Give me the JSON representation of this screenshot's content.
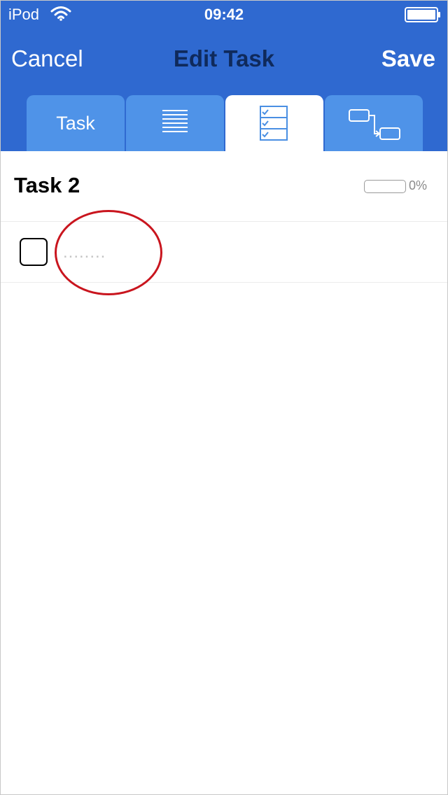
{
  "status_bar": {
    "carrier": "iPod",
    "time": "09:42",
    "wifi_icon": "wifi-icon",
    "battery_icon": "battery-full-icon"
  },
  "nav": {
    "cancel_label": "Cancel",
    "title": "Edit Task",
    "save_label": "Save"
  },
  "tabs": [
    {
      "label": "Task",
      "icon": null,
      "active": false
    },
    {
      "label": "",
      "icon": "notes-lines-icon",
      "active": false
    },
    {
      "label": "",
      "icon": "checklist-icon",
      "active": true
    },
    {
      "label": "",
      "icon": "dependencies-icon",
      "active": false
    }
  ],
  "task": {
    "name": "Task 2",
    "progress": 0,
    "progress_label": "0%"
  },
  "checklist": {
    "items": [
      {
        "checked": false,
        "text": "",
        "placeholder": "........"
      }
    ]
  },
  "colors": {
    "header_bg": "#2f69d0",
    "tab_bg": "#4f93e8",
    "title_text": "#0f2a5c",
    "annotation": "#c9151e"
  }
}
